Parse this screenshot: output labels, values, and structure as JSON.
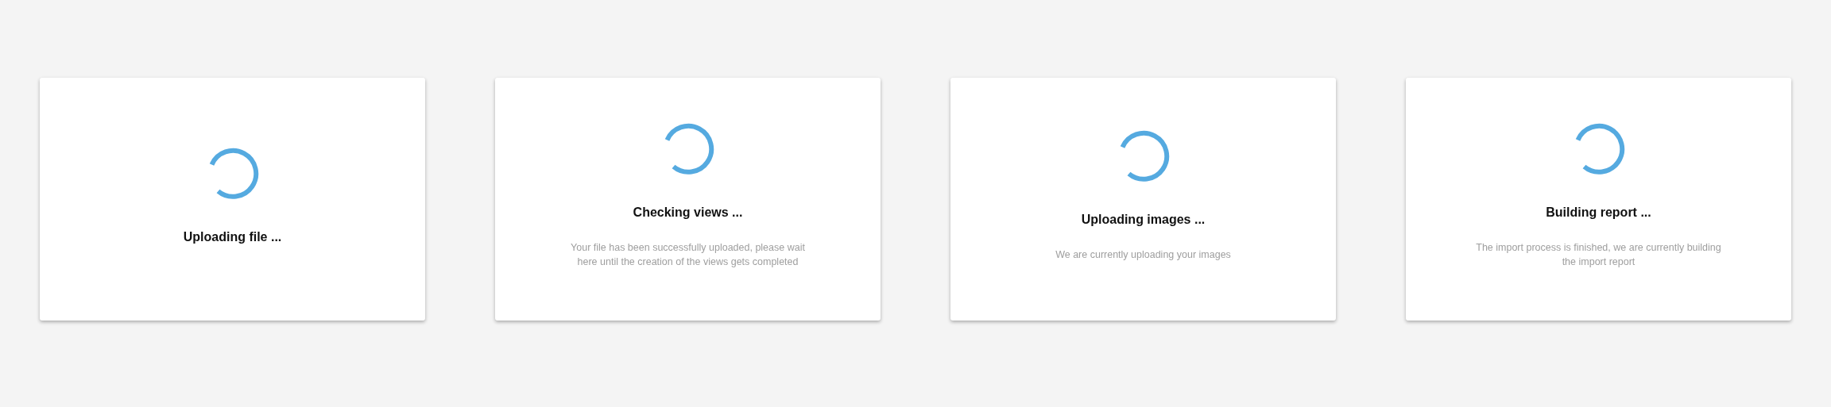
{
  "cards": [
    {
      "title": "Uploading file ..."
    },
    {
      "title": "Checking views ...",
      "description": "Your file has been successfully uploaded, please wait here until the creation of the views gets completed"
    },
    {
      "title": "Uploading images ...",
      "description": "We are currently uploading your images"
    },
    {
      "title": "Building report ...",
      "description": "The import process is finished, we are currently building the import report"
    }
  ]
}
